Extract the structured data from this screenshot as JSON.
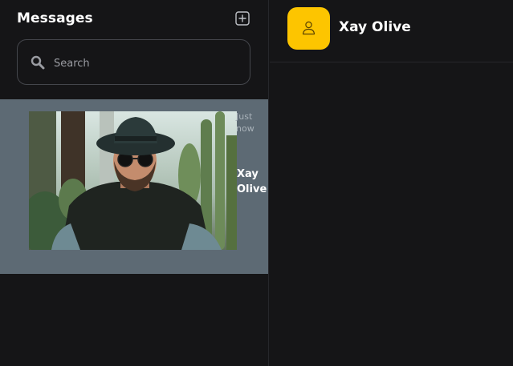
{
  "sidebar": {
    "title": "Messages",
    "new_message_icon": "plus-square-icon",
    "search": {
      "placeholder": "Search",
      "value": "",
      "icon": "search-icon"
    },
    "conversations": [
      {
        "name": "Xay Olive",
        "time": "Just now",
        "selected": true
      }
    ]
  },
  "chat": {
    "contact_name": "Xay Olive",
    "avatar_icon": "user-icon"
  },
  "colors": {
    "background": "#151517",
    "selected_item": "#5d6a74",
    "accent": "#fdc500",
    "border": "#44464c"
  }
}
